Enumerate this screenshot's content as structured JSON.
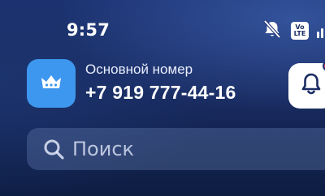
{
  "status_bar": {
    "time": "9:57",
    "volte_top": "Vo",
    "volte_bottom": "LTE",
    "icons": [
      "bell-slash-icon",
      "volte-icon",
      "signal-icon"
    ]
  },
  "account": {
    "avatar_icon": "crown-icon",
    "label": "Основной номер",
    "number": "+7 919 777-44-16"
  },
  "notifications": {
    "icon": "bell-icon",
    "has_unread": true,
    "unread_color": "#ff3b4e"
  },
  "search": {
    "placeholder": "Поиск",
    "icon": "search-icon"
  },
  "colors": {
    "accent": "#3d97ef",
    "background": "#1a2c63"
  }
}
